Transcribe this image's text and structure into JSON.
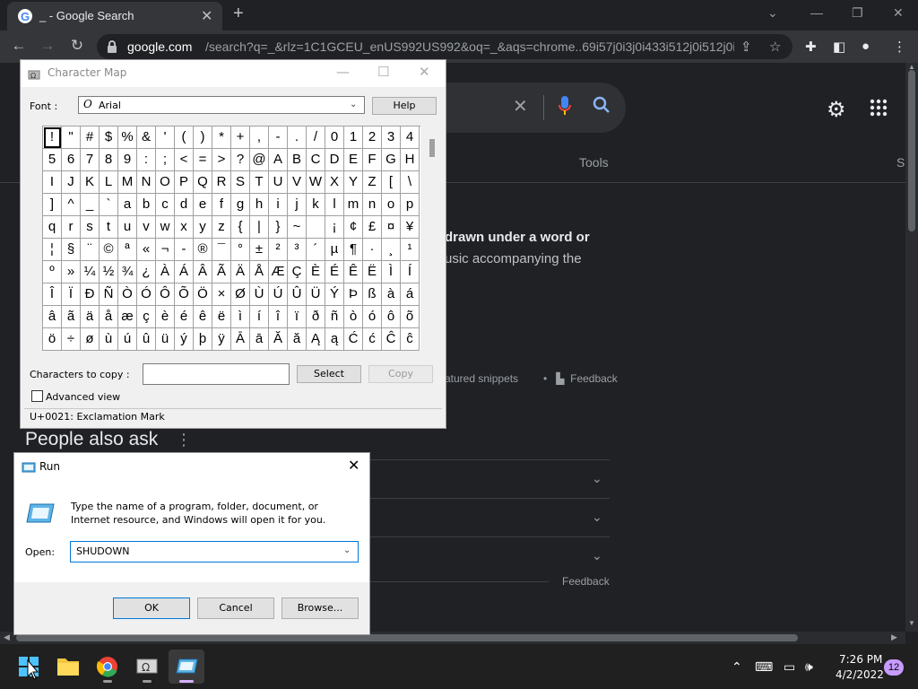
{
  "browser": {
    "tab_title": "_ - Google Search",
    "url_host": "google.com",
    "url_rest": "/search?q=_&rlz=1C1GCEU_enUS992US992&oq=_&aqs=chrome..69i57j0i3j0i433i512j0i512j0i3j..."
  },
  "google": {
    "tools_label": "Tools",
    "s_label": "S",
    "snippet_line1": "drawn under a word or",
    "snippet_line2": "usic accompanying the",
    "about_snippets": "atured snippets",
    "feedback_1": "Feedback",
    "paa_title": "People also ask",
    "feedback_2": "Feedback"
  },
  "charmap": {
    "title": "Character Map",
    "font_label": "Font :",
    "font_value": "Arial",
    "help_label": "Help",
    "rows": [
      [
        "!",
        "\"",
        "#",
        "$",
        "%",
        "&",
        "'",
        "(",
        ")",
        "*",
        "+",
        ",",
        "-",
        ".",
        "/",
        "0",
        "1",
        "2",
        "3",
        "4"
      ],
      [
        "5",
        "6",
        "7",
        "8",
        "9",
        ":",
        ";",
        "<",
        "=",
        ">",
        "?",
        "@",
        "A",
        "B",
        "C",
        "D",
        "E",
        "F",
        "G",
        "H"
      ],
      [
        "I",
        "J",
        "K",
        "L",
        "M",
        "N",
        "O",
        "P",
        "Q",
        "R",
        "S",
        "T",
        "U",
        "V",
        "W",
        "X",
        "Y",
        "Z",
        "[",
        "\\"
      ],
      [
        "]",
        "^",
        "_",
        "`",
        "a",
        "b",
        "c",
        "d",
        "e",
        "f",
        "g",
        "h",
        "i",
        "j",
        "k",
        "l",
        "m",
        "n",
        "o",
        "p"
      ],
      [
        "q",
        "r",
        "s",
        "t",
        "u",
        "v",
        "w",
        "x",
        "y",
        "z",
        "{",
        "|",
        "}",
        "~",
        "",
        "¡",
        "¢",
        "£",
        "¤",
        "¥"
      ],
      [
        "¦",
        "§",
        "¨",
        "©",
        "ª",
        "«",
        "¬",
        "-",
        "®",
        "¯",
        "°",
        "±",
        "²",
        "³",
        "´",
        "µ",
        "¶",
        "·",
        "¸",
        "¹"
      ],
      [
        "º",
        "»",
        "¼",
        "½",
        "¾",
        "¿",
        "À",
        "Á",
        "Â",
        "Ã",
        "Ä",
        "Å",
        "Æ",
        "Ç",
        "È",
        "É",
        "Ê",
        "Ë",
        "Ì",
        "Í"
      ],
      [
        "Î",
        "Ï",
        "Ð",
        "Ñ",
        "Ò",
        "Ó",
        "Ô",
        "Õ",
        "Ö",
        "×",
        "Ø",
        "Ù",
        "Ú",
        "Û",
        "Ü",
        "Ý",
        "Þ",
        "ß",
        "à",
        "á"
      ],
      [
        "â",
        "ã",
        "ä",
        "å",
        "æ",
        "ç",
        "è",
        "é",
        "ê",
        "ë",
        "ì",
        "í",
        "î",
        "ï",
        "ð",
        "ñ",
        "ò",
        "ó",
        "ô",
        "õ"
      ],
      [
        "ö",
        "÷",
        "ø",
        "ù",
        "ú",
        "û",
        "ü",
        "ý",
        "þ",
        "ÿ",
        "Ā",
        "ā",
        "Ă",
        "ă",
        "Ą",
        "ą",
        "Ć",
        "ć",
        "Ĉ",
        "ĉ"
      ]
    ],
    "copy_label": "Characters to copy :",
    "copy_value": "",
    "select_label": "Select",
    "copy_button_label": "Copy",
    "advanced_label": "Advanced view",
    "status": "U+0021: Exclamation Mark"
  },
  "run": {
    "title": "Run",
    "description": "Type the name of a program, folder, document, or Internet resource, and Windows will open it for you.",
    "open_label": "Open:",
    "open_value": "SHUDOWN",
    "ok_label": "OK",
    "cancel_label": "Cancel",
    "browse_label": "Browse..."
  },
  "taskbar": {
    "time": "7:26 PM",
    "date": "4/2/2022",
    "notification_count": "12"
  },
  "colors": {
    "chrome_bg": "#202124",
    "chrome_toolbar": "#35363a",
    "mic_blue": "#8ab4f8",
    "taskbar": "#202020",
    "badge": "#c79bff"
  }
}
